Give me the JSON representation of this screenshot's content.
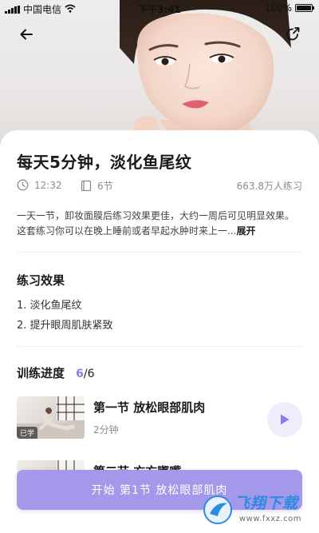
{
  "status_bar": {
    "carrier": "中国电信",
    "time": "下午3:41",
    "battery": "100%",
    "battery_level": 1.0,
    "wifi_icon": "wifi-icon",
    "signal_icon": "signal-icon"
  },
  "nav": {
    "back_icon": "back-arrow-icon",
    "share_icon": "share-icon"
  },
  "course": {
    "title": "每天5分钟，淡化鱼尾纹",
    "duration": "12:32",
    "sections": "6节",
    "practice_count": "663.8万人练习",
    "description": "一天一节，卸妆面膜后练习效果更佳，大约一周后可见明显效果。这套练习你可以在晚上睡前或者早起水肿时来上一...",
    "more_label": "展开"
  },
  "effects": {
    "heading": "练习效果",
    "items": [
      "1. 淡化鱼尾纹",
      "2. 提升眼周肌肤紧致"
    ]
  },
  "training": {
    "heading": "训练进度",
    "current": "6",
    "total": "/6"
  },
  "lessons": [
    {
      "title": "第一节 放松眼部肌肉",
      "duration": "2分钟",
      "badge": "已学"
    },
    {
      "title": "第二节 方方嘟嘴",
      "duration": "",
      "badge": ""
    }
  ],
  "cta": {
    "label": "开始 第1节  放松眼部肌肉"
  },
  "watermark": {
    "brand": "飞翔下载",
    "url": "www.fxxz.com"
  },
  "colors": {
    "accent": "#8a7fe6",
    "cta_bg": "#a498ea",
    "play_bg": "#efedfb",
    "watermark_blue": "#2d8be0"
  }
}
